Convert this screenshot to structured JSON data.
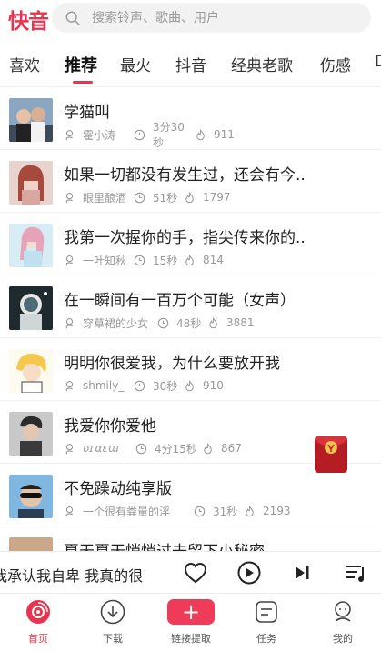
{
  "header": {
    "logo": "快音",
    "search_placeholder": "搜索铃声、歌曲、用户"
  },
  "tabs": [
    "喜欢",
    "推荐",
    "最火",
    "抖音",
    "经典老歌",
    "伤感",
    "D"
  ],
  "active_tab": "推荐",
  "songs": [
    {
      "title": "学猫叫",
      "author": "霍小涛",
      "duration": "3分30秒",
      "plays": "911"
    },
    {
      "title": "如果一切都没有发生过，还会有今..",
      "author": "眼里酿酒",
      "duration": "51秒",
      "plays": "1797"
    },
    {
      "title": "我第一次握你的手，指尖传来你的..",
      "author": "一叶知秋",
      "duration": "15秒",
      "plays": "814"
    },
    {
      "title": "在一瞬间有一百万个可能（女声）",
      "author": "穿草裙的少女",
      "duration": "48秒",
      "plays": "3881"
    },
    {
      "title": "明明你很爱我，为什么要放开我",
      "author": "shmily_",
      "duration": "30秒",
      "plays": "910"
    },
    {
      "title": "我爱你你爱他",
      "author": "ʋɾαɛɯ",
      "duration": "4分15秒",
      "plays": "867"
    },
    {
      "title": "不免躁动纯享版",
      "author": "一个很有粪量的淫",
      "duration": "31秒",
      "plays": "2193"
    },
    {
      "title": "夏天夏天悄悄过去留下小秘密",
      "author": "",
      "duration": "",
      "plays": ""
    }
  ],
  "player": {
    "now_playing": "我承认我自卑 我真的很"
  },
  "nav": [
    {
      "label": "首页",
      "icon": "home-disc-icon",
      "active": true
    },
    {
      "label": "下载",
      "icon": "download-icon",
      "active": false
    },
    {
      "label": "链接提取",
      "icon": "plus-icon",
      "active": false
    },
    {
      "label": "任务",
      "icon": "task-icon",
      "active": false
    },
    {
      "label": "我的",
      "icon": "profile-icon",
      "active": false
    }
  ],
  "colors": {
    "accent": "#e8344f",
    "muted": "#999999"
  }
}
